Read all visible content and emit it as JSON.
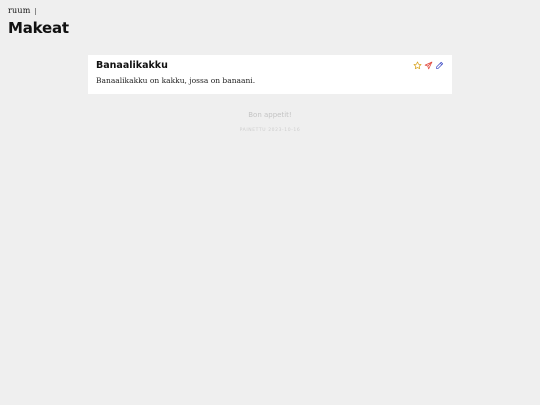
{
  "header": {
    "logo_text": "ruum",
    "page_title": "Makeat"
  },
  "recipe": {
    "title": "Banaalikakku",
    "description": "Banaalikakku on kakku, jossa on banaani."
  },
  "actions": {
    "favorite_icon": "star-icon",
    "share_icon": "paper-plane-icon",
    "edit_icon": "pencil-icon"
  },
  "footer": {
    "message": "Bon appetit!",
    "printed": "PAINETTU 2023-10-16"
  },
  "colors": {
    "background": "#efefef",
    "card": "#ffffff",
    "star": "#d9a522",
    "share": "#e0453a",
    "edit": "#4a56c8"
  }
}
